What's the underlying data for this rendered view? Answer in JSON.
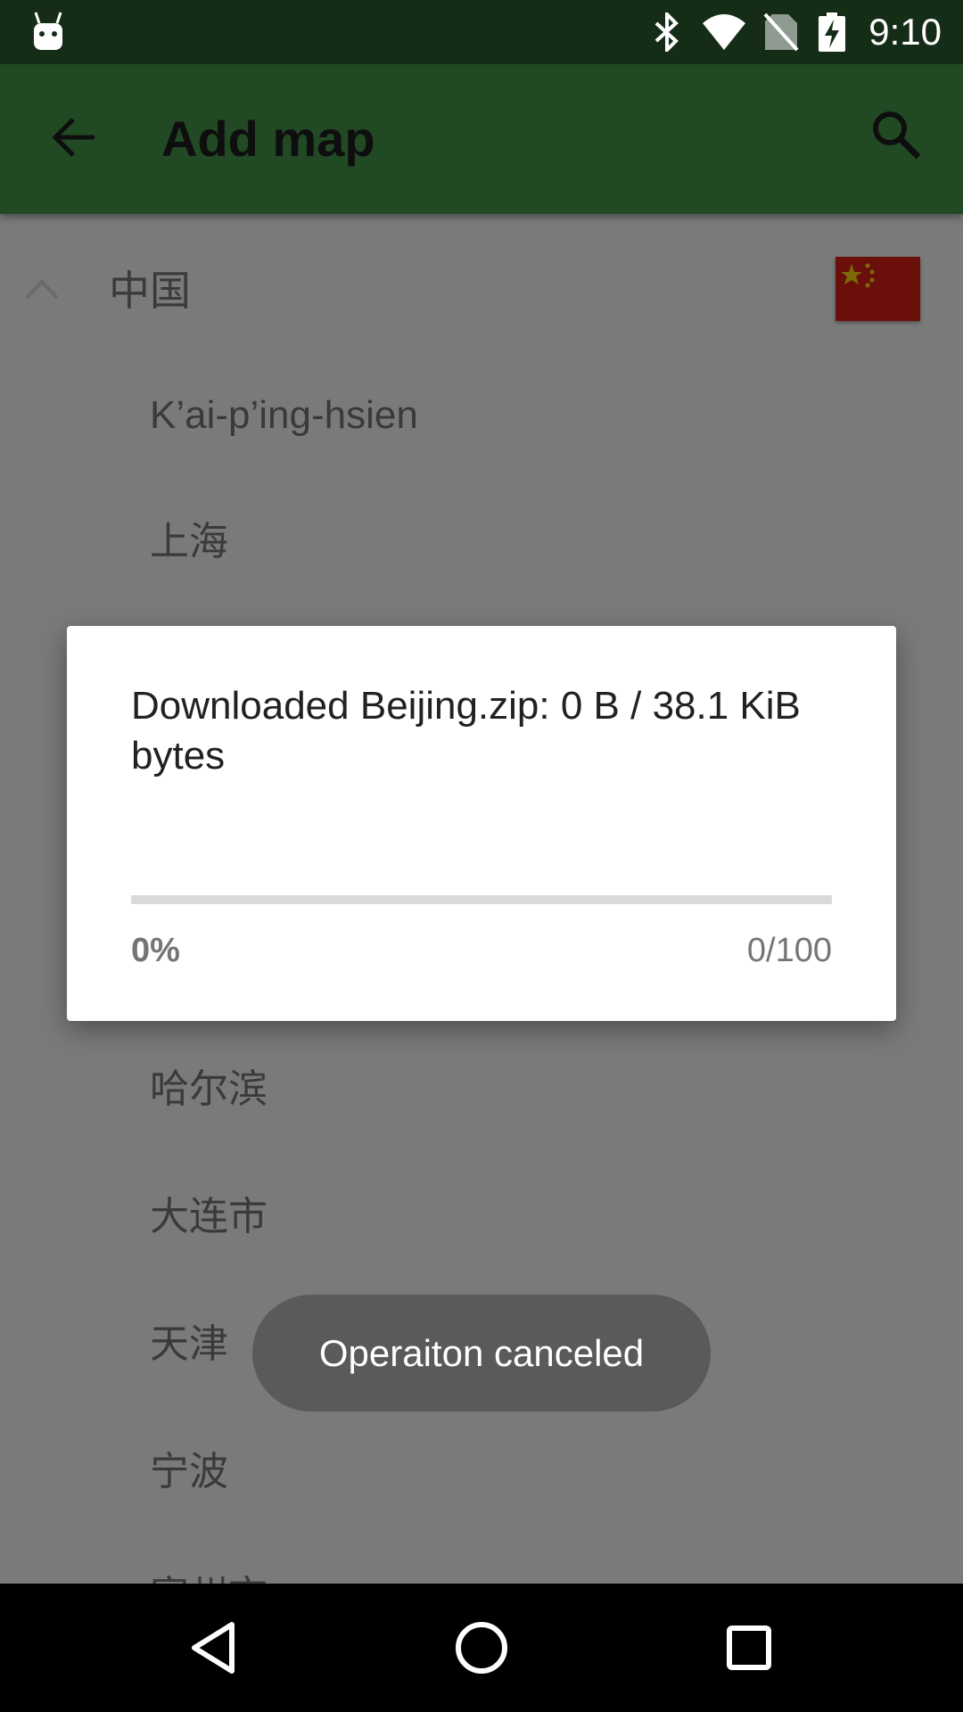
{
  "status_bar": {
    "time": "9:10",
    "icons": [
      "android-icon",
      "bluetooth-icon",
      "wifi-icon",
      "no-sim-icon",
      "battery-charging-icon"
    ]
  },
  "app_bar": {
    "title": "Add map",
    "back_icon": "arrow-back-icon",
    "search_icon": "search-icon",
    "background_color": "#214a24"
  },
  "list": {
    "group": {
      "label": "中国",
      "expanded": true,
      "flag": "china-flag-icon"
    },
    "items": [
      {
        "label": "K’ai-p’ing-hsien"
      },
      {
        "label": "上海"
      },
      {
        "label": "哈尔滨"
      },
      {
        "label": "大连市"
      },
      {
        "label": "天津"
      },
      {
        "label": "宁波"
      },
      {
        "label": "宿州市"
      }
    ]
  },
  "dialog": {
    "message": "Downloaded Beijing.zip: 0 B / 38.1 KiB bytes",
    "progress": 0,
    "percent_label": "0%",
    "ratio_label": "0/100"
  },
  "toast": {
    "text": "Operaiton canceled"
  },
  "nav_bar": {
    "icons": [
      "back-triangle-icon",
      "home-circle-icon",
      "recents-square-icon"
    ]
  }
}
